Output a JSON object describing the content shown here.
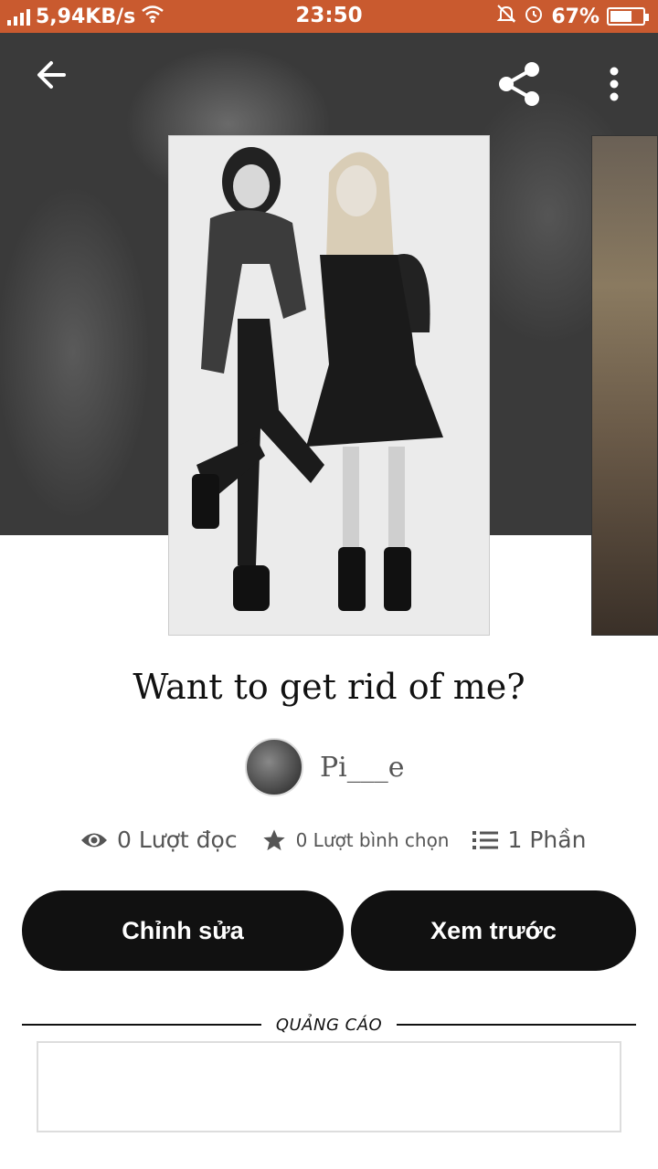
{
  "status_bar": {
    "network_speed": "5,94KB/s",
    "time": "23:50",
    "battery_percent": "67%",
    "battery_level": 0.67
  },
  "header": {
    "back_icon": "arrow-left-icon",
    "share_icon": "share-icon",
    "more_icon": "more-vertical-icon"
  },
  "story": {
    "title": "Want to get rid of me?",
    "author": "Pi___e"
  },
  "stats": {
    "reads": "0 Lượt đọc",
    "votes": "0 Lượt bình chọn",
    "parts": "1 Phần"
  },
  "actions": {
    "edit_label": "Chỉnh sửa",
    "preview_label": "Xem trước"
  },
  "ad": {
    "label": "QUẢNG CÁO"
  },
  "colors": {
    "status_bar": "#c95a2f",
    "button_bg": "#111111",
    "hero_bg": "#3a3a3a"
  }
}
